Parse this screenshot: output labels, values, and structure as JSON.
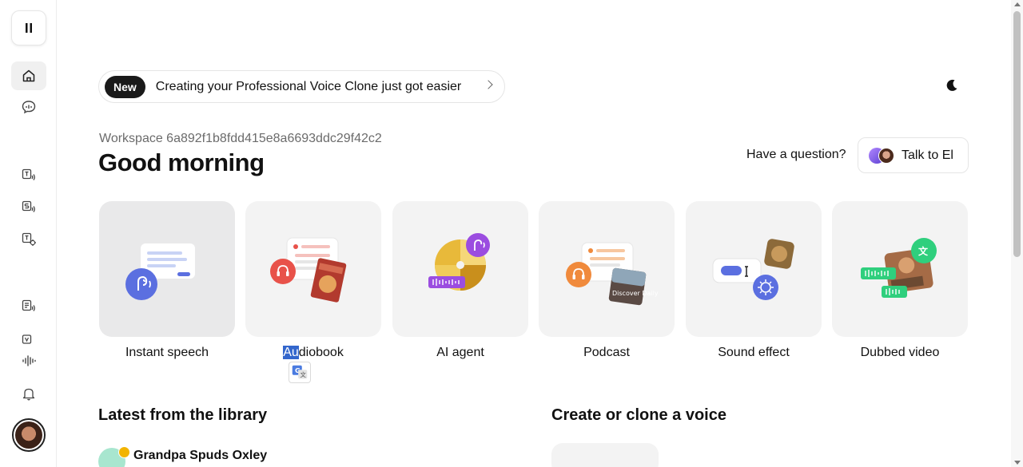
{
  "announcement": {
    "badge": "New",
    "text": "Creating your Professional Voice Clone just got easier"
  },
  "workspace": "Workspace 6a892f1b8fdd415e8a6693ddc29f42c2",
  "greeting": "Good morning",
  "help": {
    "question": "Have a question?",
    "button": "Talk to El"
  },
  "cards": [
    {
      "label": "Instant speech"
    },
    {
      "label_highlight": "Au",
      "label_rest": "diobook"
    },
    {
      "label": "AI agent"
    },
    {
      "label": "Podcast"
    },
    {
      "label": "Sound effect"
    },
    {
      "label": "Dubbed video"
    }
  ],
  "podcast_cover_text": "Discover Daily",
  "sections": {
    "library": "Latest from the library",
    "clone": "Create or clone a voice"
  },
  "library_items": [
    {
      "name": "Grandpa Spuds Oxley"
    }
  ],
  "colors": {
    "accent_blue": "#5b6fe0",
    "accent_purple": "#9b4de0",
    "accent_red": "#e8524a",
    "accent_orange": "#f08a3c",
    "accent_green": "#2fcf7d"
  }
}
